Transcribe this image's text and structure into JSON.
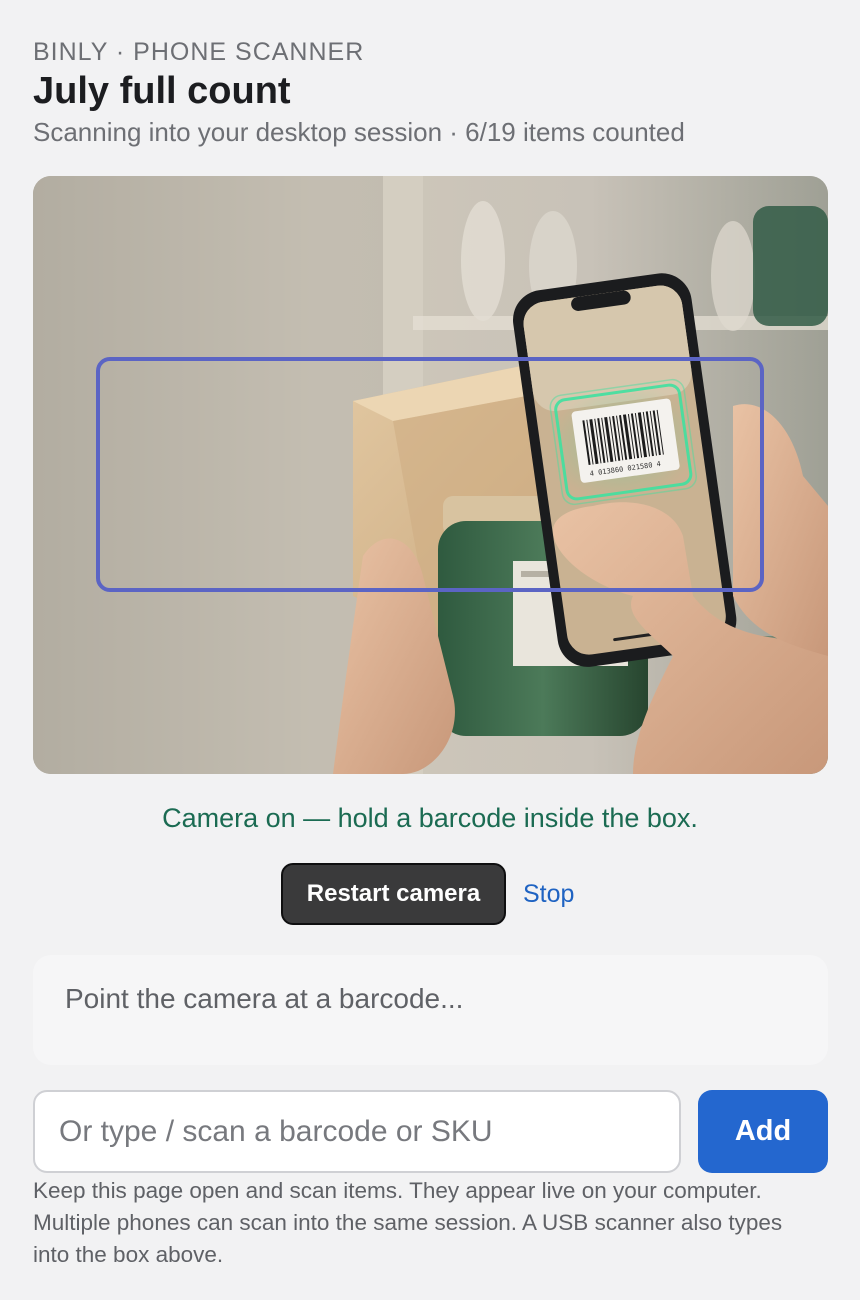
{
  "header": {
    "eyebrow": "BINLY · PHONE SCANNER",
    "title": "July full count",
    "subtitle": "Scanning into your desktop session · 6/19 items counted"
  },
  "camera": {
    "status": "Camera on — hold a barcode inside the box.",
    "restart_label": "Restart camera",
    "stop_label": "Stop",
    "barcode_digits": "4 013860 021580 4"
  },
  "result": {
    "text": "Point the camera at a barcode..."
  },
  "entry": {
    "placeholder": "Or type / scan a barcode or SKU",
    "value": "",
    "add_label": "Add"
  },
  "help": {
    "text": "Keep this page open and scan items. They appear live on your computer. Multiple phones can scan into the same session. A USB scanner also types into the box above."
  },
  "colors": {
    "accent": "#2467cf",
    "status": "#1b6b52",
    "scan_box": "#5b64c4",
    "scan_glow": "#3fe0a0"
  }
}
